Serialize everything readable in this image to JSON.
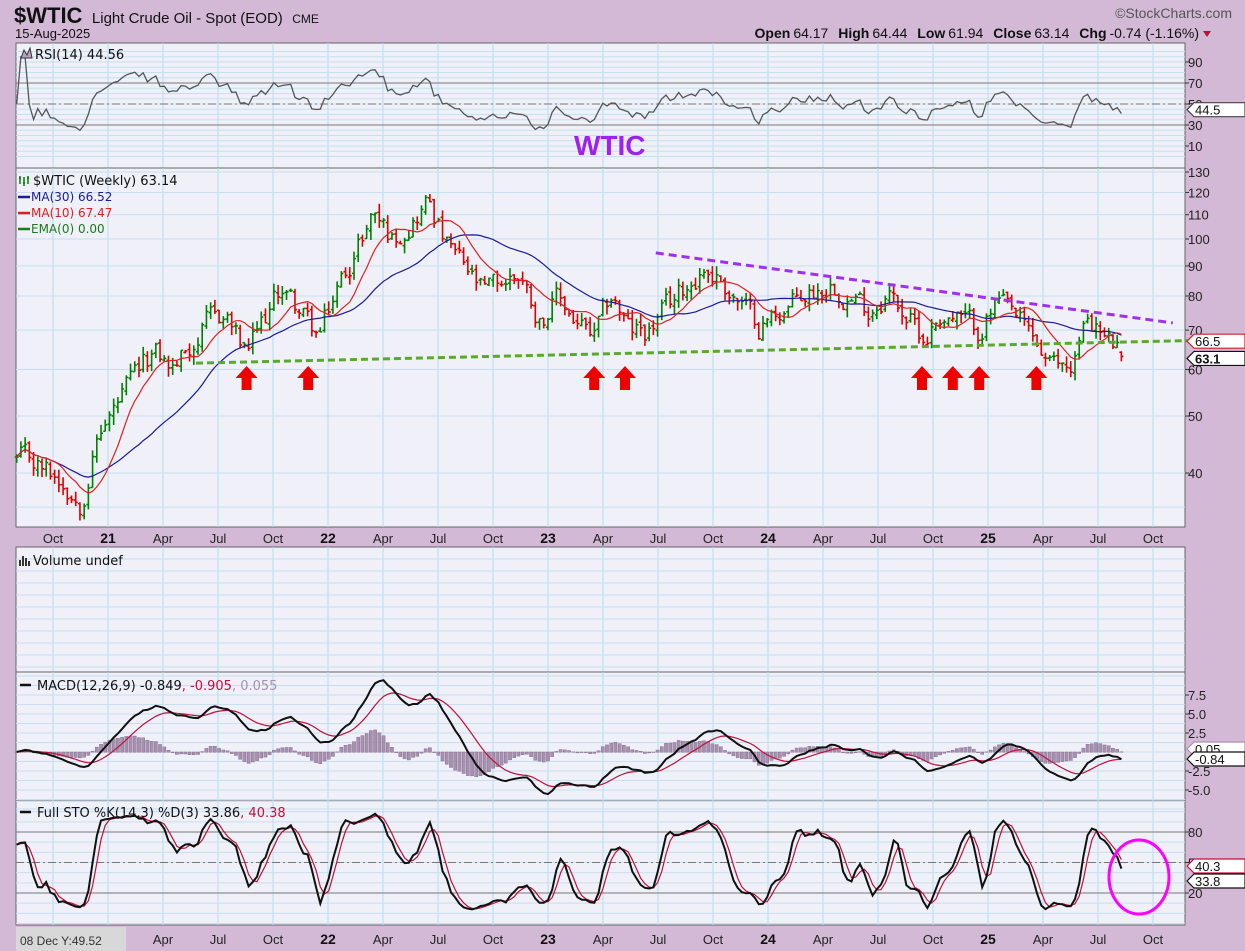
{
  "header": {
    "symbol": "$WTIC",
    "name": "Light Crude Oil - Spot (EOD)",
    "exchange": "CME",
    "date": "15-Aug-2025",
    "brand": "©StockCharts.com",
    "open_label": "Open",
    "open": "64.17",
    "high_label": "High",
    "high": "64.44",
    "low_label": "Low",
    "low": "61.94",
    "close_label": "Close",
    "close": "63.14",
    "chg_label": "Chg",
    "chg": "-0.74 (-1.16%)",
    "chg_icon": "down-triangle-icon"
  },
  "annotation_title": "WTIC",
  "colors": {
    "up": "#008000",
    "down": "#e00000",
    "ma30": "#1b1b9a",
    "ma10": "#e02020",
    "ema": "#1e7a1e",
    "resistance": "#a030f0",
    "support": "#5aaa2a",
    "arrow": "#ee0000",
    "circle": "#ff00ff",
    "title": "#a020f0"
  },
  "rsi": {
    "label": "RSI(14) 44.56",
    "ticks": [
      "90",
      "70",
      "50",
      "30",
      "10"
    ],
    "value_box": "44.5"
  },
  "price": {
    "label": "$WTIC (Weekly) 63.14",
    "legend": [
      {
        "label": "MA(30) 66.52",
        "key": "ma30"
      },
      {
        "label": "MA(10) 67.47",
        "key": "ma10"
      },
      {
        "label": "EMA(0) 0.00",
        "key": "ema"
      }
    ],
    "ticks": [
      "130",
      "120",
      "110",
      "100",
      "90",
      "80",
      "70",
      "60",
      "50",
      "40"
    ],
    "value_boxes": [
      "66.5",
      "63.1"
    ]
  },
  "volume": {
    "label": "Volume undef"
  },
  "macd": {
    "label_main": "MACD(12,26,9) -0.849",
    "label_signal": ", -0.905",
    "label_hist": ", 0.055",
    "ticks": [
      "7.5",
      "5.0",
      "2.5",
      "-2.5",
      "-5.0"
    ],
    "value_boxes": [
      "0.05",
      "-0.84"
    ]
  },
  "sto": {
    "label_main": "Full STO %K(14,3) %D(3) 33.86",
    "label_d": ", 40.38",
    "ticks": [
      "80",
      "50",
      "20"
    ],
    "value_boxes": [
      "40.3",
      "33.8"
    ]
  },
  "x_axis": {
    "labels": [
      "Oct",
      "21",
      "Apr",
      "Jul",
      "Oct",
      "22",
      "Apr",
      "Jul",
      "Oct",
      "23",
      "Apr",
      "Jul",
      "Oct",
      "24",
      "Apr",
      "Jul",
      "Oct",
      "25",
      "Apr",
      "Jul",
      "Oct"
    ]
  },
  "crosshair_readout": "08 Dec Y:49.52",
  "chart_data": {
    "type": "ohlc",
    "title": "$WTIC Light Crude Oil - Spot (EOD) Weekly",
    "y_scale": "log",
    "ylim": [
      30,
      132
    ],
    "x_range": [
      "2020-08",
      "2025-10"
    ],
    "last_bar": {
      "open": 64.17,
      "high": 64.44,
      "low": 61.94,
      "close": 63.14
    },
    "approx_weekly_close_anchors": [
      [
        "2020-08",
        42
      ],
      [
        "2020-10",
        39
      ],
      [
        "2020-11",
        36
      ],
      [
        "2020-12",
        47
      ],
      [
        "2021-01",
        52
      ],
      [
        "2021-03",
        64
      ],
      [
        "2021-04",
        60
      ],
      [
        "2021-06",
        72
      ],
      [
        "2021-07",
        74
      ],
      [
        "2021-08",
        63
      ],
      [
        "2021-10",
        83
      ],
      [
        "2021-12",
        68
      ],
      [
        "2022-01",
        82
      ],
      [
        "2022-03",
        112
      ],
      [
        "2022-04",
        100
      ],
      [
        "2022-06",
        117
      ],
      [
        "2022-07",
        97
      ],
      [
        "2022-09",
        80
      ],
      [
        "2022-11",
        88
      ],
      [
        "2022-12",
        73
      ],
      [
        "2023-01",
        79
      ],
      [
        "2023-03",
        67
      ],
      [
        "2023-04",
        80
      ],
      [
        "2023-05",
        69
      ],
      [
        "2023-06",
        70
      ],
      [
        "2023-09",
        90
      ],
      [
        "2023-10",
        85
      ],
      [
        "2023-12",
        71
      ],
      [
        "2024-01",
        75
      ],
      [
        "2024-04",
        85
      ],
      [
        "2024-06",
        76
      ],
      [
        "2024-07",
        82
      ],
      [
        "2024-09",
        68
      ],
      [
        "2024-10",
        75
      ],
      [
        "2024-12",
        70
      ],
      [
        "2025-01",
        78
      ],
      [
        "2025-03",
        67
      ],
      [
        "2025-04",
        60
      ],
      [
        "2025-05",
        61
      ],
      [
        "2025-06",
        74
      ],
      [
        "2025-07",
        67
      ],
      [
        "2025-08",
        63
      ]
    ],
    "overlays": [
      "MA(30)",
      "MA(10)",
      "EMA(0)"
    ],
    "indicators": [
      "RSI(14)",
      "Volume",
      "MACD(12,26,9)",
      "Full STO %K(14,3) %D(3)"
    ],
    "resistance_line": [
      [
        2023.49,
        94.7
      ],
      [
        2025.84,
        72
      ]
    ],
    "support_line": [
      [
        2021.4,
        61.5
      ],
      [
        2025.93,
        67.2
      ]
    ],
    "support_arrows_at": [
      2021.63,
      2021.91,
      2023.21,
      2023.35,
      2024.7,
      2024.84,
      2024.96,
      2025.22
    ]
  }
}
